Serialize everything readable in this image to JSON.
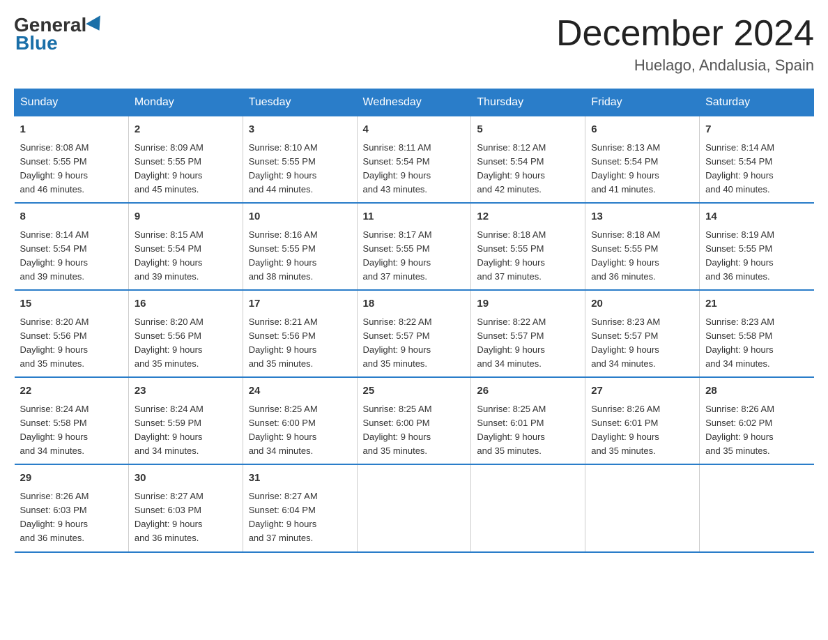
{
  "logo": {
    "general": "General",
    "blue": "Blue"
  },
  "title": "December 2024",
  "location": "Huelago, Andalusia, Spain",
  "days_of_week": [
    "Sunday",
    "Monday",
    "Tuesday",
    "Wednesday",
    "Thursday",
    "Friday",
    "Saturday"
  ],
  "weeks": [
    [
      {
        "day": "1",
        "sunrise": "8:08 AM",
        "sunset": "5:55 PM",
        "daylight": "9 hours and 46 minutes."
      },
      {
        "day": "2",
        "sunrise": "8:09 AM",
        "sunset": "5:55 PM",
        "daylight": "9 hours and 45 minutes."
      },
      {
        "day": "3",
        "sunrise": "8:10 AM",
        "sunset": "5:55 PM",
        "daylight": "9 hours and 44 minutes."
      },
      {
        "day": "4",
        "sunrise": "8:11 AM",
        "sunset": "5:54 PM",
        "daylight": "9 hours and 43 minutes."
      },
      {
        "day": "5",
        "sunrise": "8:12 AM",
        "sunset": "5:54 PM",
        "daylight": "9 hours and 42 minutes."
      },
      {
        "day": "6",
        "sunrise": "8:13 AM",
        "sunset": "5:54 PM",
        "daylight": "9 hours and 41 minutes."
      },
      {
        "day": "7",
        "sunrise": "8:14 AM",
        "sunset": "5:54 PM",
        "daylight": "9 hours and 40 minutes."
      }
    ],
    [
      {
        "day": "8",
        "sunrise": "8:14 AM",
        "sunset": "5:54 PM",
        "daylight": "9 hours and 39 minutes."
      },
      {
        "day": "9",
        "sunrise": "8:15 AM",
        "sunset": "5:54 PM",
        "daylight": "9 hours and 39 minutes."
      },
      {
        "day": "10",
        "sunrise": "8:16 AM",
        "sunset": "5:55 PM",
        "daylight": "9 hours and 38 minutes."
      },
      {
        "day": "11",
        "sunrise": "8:17 AM",
        "sunset": "5:55 PM",
        "daylight": "9 hours and 37 minutes."
      },
      {
        "day": "12",
        "sunrise": "8:18 AM",
        "sunset": "5:55 PM",
        "daylight": "9 hours and 37 minutes."
      },
      {
        "day": "13",
        "sunrise": "8:18 AM",
        "sunset": "5:55 PM",
        "daylight": "9 hours and 36 minutes."
      },
      {
        "day": "14",
        "sunrise": "8:19 AM",
        "sunset": "5:55 PM",
        "daylight": "9 hours and 36 minutes."
      }
    ],
    [
      {
        "day": "15",
        "sunrise": "8:20 AM",
        "sunset": "5:56 PM",
        "daylight": "9 hours and 35 minutes."
      },
      {
        "day": "16",
        "sunrise": "8:20 AM",
        "sunset": "5:56 PM",
        "daylight": "9 hours and 35 minutes."
      },
      {
        "day": "17",
        "sunrise": "8:21 AM",
        "sunset": "5:56 PM",
        "daylight": "9 hours and 35 minutes."
      },
      {
        "day": "18",
        "sunrise": "8:22 AM",
        "sunset": "5:57 PM",
        "daylight": "9 hours and 35 minutes."
      },
      {
        "day": "19",
        "sunrise": "8:22 AM",
        "sunset": "5:57 PM",
        "daylight": "9 hours and 34 minutes."
      },
      {
        "day": "20",
        "sunrise": "8:23 AM",
        "sunset": "5:57 PM",
        "daylight": "9 hours and 34 minutes."
      },
      {
        "day": "21",
        "sunrise": "8:23 AM",
        "sunset": "5:58 PM",
        "daylight": "9 hours and 34 minutes."
      }
    ],
    [
      {
        "day": "22",
        "sunrise": "8:24 AM",
        "sunset": "5:58 PM",
        "daylight": "9 hours and 34 minutes."
      },
      {
        "day": "23",
        "sunrise": "8:24 AM",
        "sunset": "5:59 PM",
        "daylight": "9 hours and 34 minutes."
      },
      {
        "day": "24",
        "sunrise": "8:25 AM",
        "sunset": "6:00 PM",
        "daylight": "9 hours and 34 minutes."
      },
      {
        "day": "25",
        "sunrise": "8:25 AM",
        "sunset": "6:00 PM",
        "daylight": "9 hours and 35 minutes."
      },
      {
        "day": "26",
        "sunrise": "8:25 AM",
        "sunset": "6:01 PM",
        "daylight": "9 hours and 35 minutes."
      },
      {
        "day": "27",
        "sunrise": "8:26 AM",
        "sunset": "6:01 PM",
        "daylight": "9 hours and 35 minutes."
      },
      {
        "day": "28",
        "sunrise": "8:26 AM",
        "sunset": "6:02 PM",
        "daylight": "9 hours and 35 minutes."
      }
    ],
    [
      {
        "day": "29",
        "sunrise": "8:26 AM",
        "sunset": "6:03 PM",
        "daylight": "9 hours and 36 minutes."
      },
      {
        "day": "30",
        "sunrise": "8:27 AM",
        "sunset": "6:03 PM",
        "daylight": "9 hours and 36 minutes."
      },
      {
        "day": "31",
        "sunrise": "8:27 AM",
        "sunset": "6:04 PM",
        "daylight": "9 hours and 37 minutes."
      },
      null,
      null,
      null,
      null
    ]
  ],
  "labels": {
    "sunrise": "Sunrise:",
    "sunset": "Sunset:",
    "daylight": "Daylight:"
  }
}
